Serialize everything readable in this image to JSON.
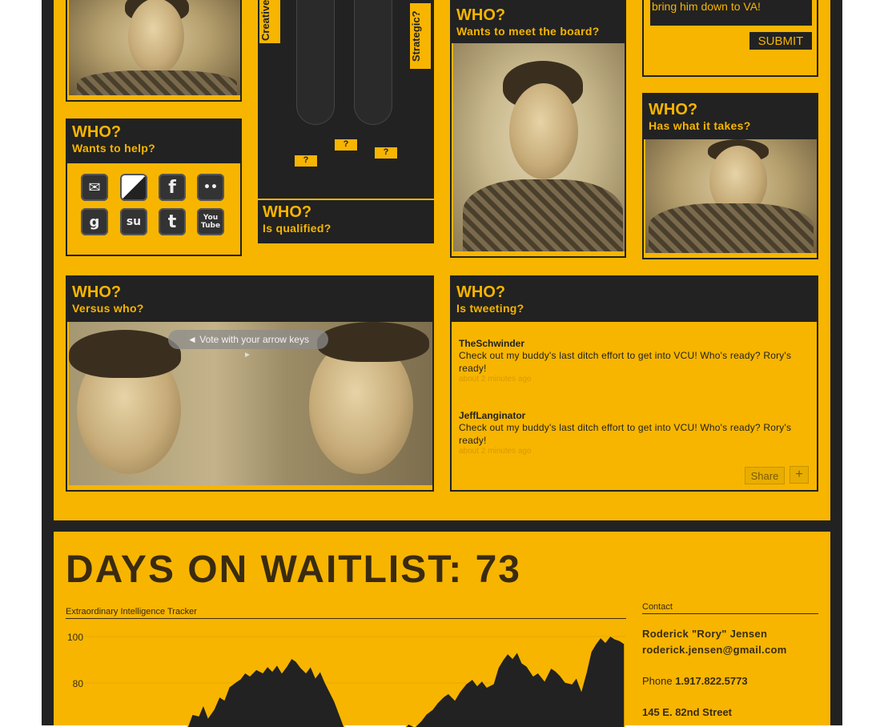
{
  "boxes": {
    "help": {
      "who": "WHO?",
      "sub": "Wants to help?"
    },
    "qualified": {
      "who": "WHO?",
      "sub": "Is qualified?",
      "label_creative": "Creative",
      "label_strategic": "Strategic?",
      "q": "?"
    },
    "board": {
      "who": "WHO?",
      "sub": "Wants to meet the board?"
    },
    "takes": {
      "who": "WHO?",
      "sub": "Has what it takes?"
    },
    "versus": {
      "who": "WHO?",
      "sub": "Versus who?",
      "vote_hint": "◄  Vote with your arrow keys",
      "arrow": "►"
    },
    "tweeting": {
      "who": "WHO?",
      "sub": "Is tweeting?"
    }
  },
  "submit": {
    "partial_text": "bring him down to VA!",
    "button": "SUBMIT"
  },
  "social_icons": [
    {
      "name": "email-icon",
      "glyph": "✉"
    },
    {
      "name": "delicious-icon",
      "glyph": "▚"
    },
    {
      "name": "facebook-icon",
      "glyph": "f"
    },
    {
      "name": "flickr-icon",
      "glyph": "••"
    },
    {
      "name": "google-icon",
      "glyph": "g"
    },
    {
      "name": "stumbleupon-icon",
      "glyph": "su"
    },
    {
      "name": "twitter-icon",
      "glyph": "t"
    },
    {
      "name": "youtube-icon",
      "glyph": "You Tube"
    }
  ],
  "tweets": [
    {
      "user": "TheSchwinder",
      "text": "Check out my buddy's last ditch effort to get into VCU! Who's ready? Rory's ready!",
      "time": "about 2 minutes ago"
    },
    {
      "user": "JeffLanginator",
      "text": "Check out my buddy's last ditch effort to get into VCU! Who's ready? Rory's ready!",
      "time": "about 2 minutes ago"
    }
  ],
  "tweet_buttons": {
    "share": "Share",
    "plus": "+"
  },
  "waitlist": {
    "title": "DAYS ON WAITLIST: 73"
  },
  "tracker": {
    "label": "Extraordinary Intelligence Tracker",
    "tick_100": "100",
    "tick_80": "80"
  },
  "contact": {
    "heading": "Contact",
    "name": "Roderick \"Rory\" Jensen",
    "email": "roderick.jensen@gmail.com",
    "phone_label": "Phone",
    "phone": "1.917.822.5773",
    "address": "145 E. 82nd Street"
  },
  "colors": {
    "accent": "#f7b500",
    "dark": "#222222"
  }
}
